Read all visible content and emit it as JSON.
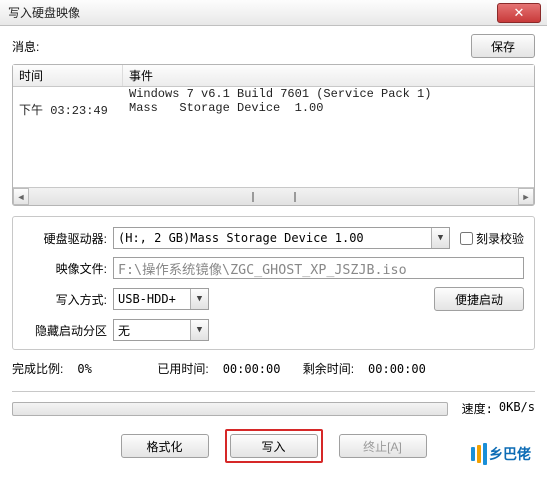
{
  "window": {
    "title": "写入硬盘映像"
  },
  "buttons": {
    "save": "保存",
    "format": "格式化",
    "write": "写入",
    "abort": "终止[A]",
    "convenient_boot": "便捷启动"
  },
  "info_label": "消息:",
  "log": {
    "header_time": "时间",
    "header_event": "事件",
    "rows": [
      {
        "time": "",
        "event": "Windows 7 v6.1 Build 7601 (Service Pack 1)"
      },
      {
        "time": "下午 03:23:49",
        "event": "Mass   Storage Device  1.00"
      }
    ]
  },
  "form": {
    "drive_label": "硬盘驱动器:",
    "drive_value": "(H:, 2 GB)Mass   Storage Device  1.00",
    "verify_label": "刻录校验",
    "image_label": "映像文件:",
    "image_value": "F:\\操作系统镜像\\ZGC_GHOST_XP_JSZJB.iso",
    "write_mode_label": "写入方式:",
    "write_mode_value": "USB-HDD+",
    "hidden_boot_label": "隐藏启动分区",
    "hidden_boot_value": "无"
  },
  "status": {
    "percent_label": "完成比例:",
    "percent_value": "0%",
    "elapsed_label": "已用时间:",
    "elapsed_value": "00:00:00",
    "remain_label": "剩余时间:",
    "remain_value": "00:00:00",
    "speed_label": "速度:",
    "speed_value": "0KB/s"
  },
  "logo_text": "乡巴佬"
}
